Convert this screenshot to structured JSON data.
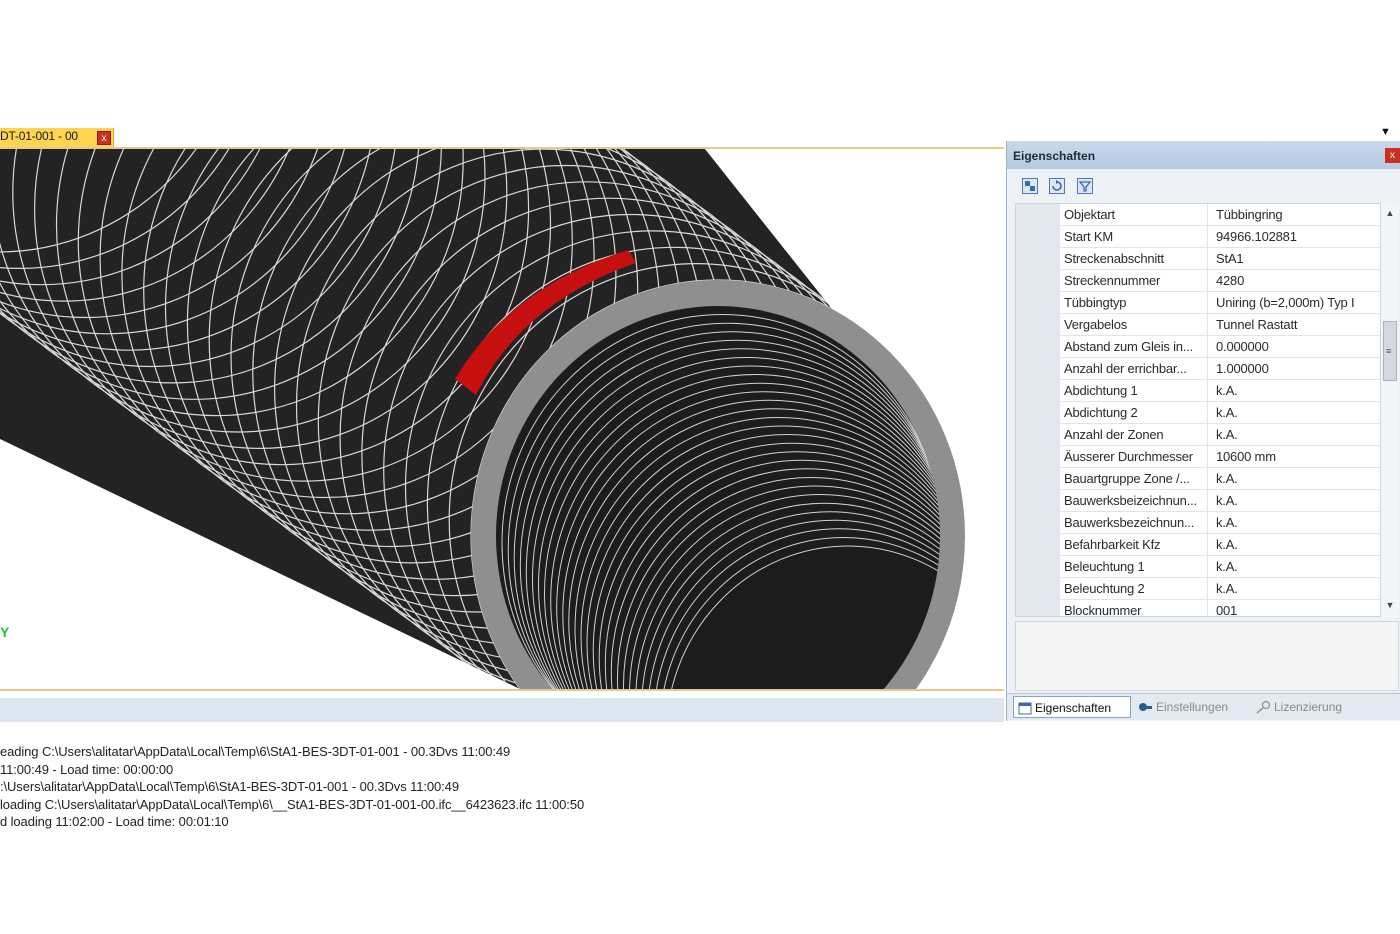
{
  "document_tab": {
    "label": "DT-01-001 - 00",
    "close_label": "x"
  },
  "viewport": {
    "axis_label": "Y"
  },
  "properties_panel": {
    "title": "Eigenschaften",
    "close_label": "x",
    "toolbar": [
      {
        "icon": "categorize-icon"
      },
      {
        "icon": "refresh-icon"
      },
      {
        "icon": "filter-icon"
      }
    ],
    "rows": [
      {
        "name": "Objektart",
        "value": "Tübbingring"
      },
      {
        "name": "Start KM",
        "value": "94966.102881"
      },
      {
        "name": "Streckenabschnitt",
        "value": "StA1"
      },
      {
        "name": "Streckennummer",
        "value": "4280"
      },
      {
        "name": "Tübbingtyp",
        "value": "Uniring (b=2,000m) Typ I"
      },
      {
        "name": "Vergabelos",
        "value": "Tunnel Rastatt"
      },
      {
        "name": "Abstand zum Gleis in...",
        "value": "0.000000"
      },
      {
        "name": "Anzahl der errichbar...",
        "value": "1.000000"
      },
      {
        "name": "Abdichtung 1",
        "value": "k.A."
      },
      {
        "name": "Abdichtung 2",
        "value": "k.A."
      },
      {
        "name": "Anzahl der Zonen",
        "value": "k.A."
      },
      {
        "name": "Äusserer Durchmesser",
        "value": "10600 mm"
      },
      {
        "name": "Bauartgruppe Zone /...",
        "value": "k.A."
      },
      {
        "name": "Bauwerksbeizeichnun...",
        "value": "k.A."
      },
      {
        "name": "Bauwerksbezeichnun...",
        "value": "k.A."
      },
      {
        "name": "Befahrbarkeit Kfz",
        "value": "k.A."
      },
      {
        "name": "Beleuchtung 1",
        "value": "k.A."
      },
      {
        "name": "Beleuchtung 2",
        "value": "k.A."
      },
      {
        "name": "Blocknummer",
        "value": "001"
      }
    ],
    "tabs": [
      {
        "label": "Eigenschaften",
        "icon": "properties-icon",
        "active": true
      },
      {
        "label": "Einstellungen",
        "icon": "settings-icon",
        "active": false
      },
      {
        "label": "Lizenzierung",
        "icon": "license-key-icon",
        "active": false
      }
    ]
  },
  "log": [
    "eading C:\\Users\\alitatar\\AppData\\Local\\Temp\\6\\StA1-BES-3DT-01-001 - 00.3Dvs 11:00:49",
    "11:00:49 - Load time: 00:00:00",
    ":\\Users\\alitatar\\AppData\\Local\\Temp\\6\\StA1-BES-3DT-01-001 - 00.3Dvs 11:00:49",
    " loading C:\\Users\\alitatar\\AppData\\Local\\Temp\\6\\__StA1-BES-3DT-01-001-00.ifc__6423623.ifc 11:00:50",
    "d loading 11:02:00 - Load time: 00:01:10"
  ],
  "colors": {
    "tunnel_body": "#232323",
    "ring_joint": "#d9d9d9",
    "tunnel_face": "#8f8f8f",
    "highlight_segment": "#c60f0f",
    "tab_active": "#ffd451",
    "axis": "#19c43a"
  }
}
